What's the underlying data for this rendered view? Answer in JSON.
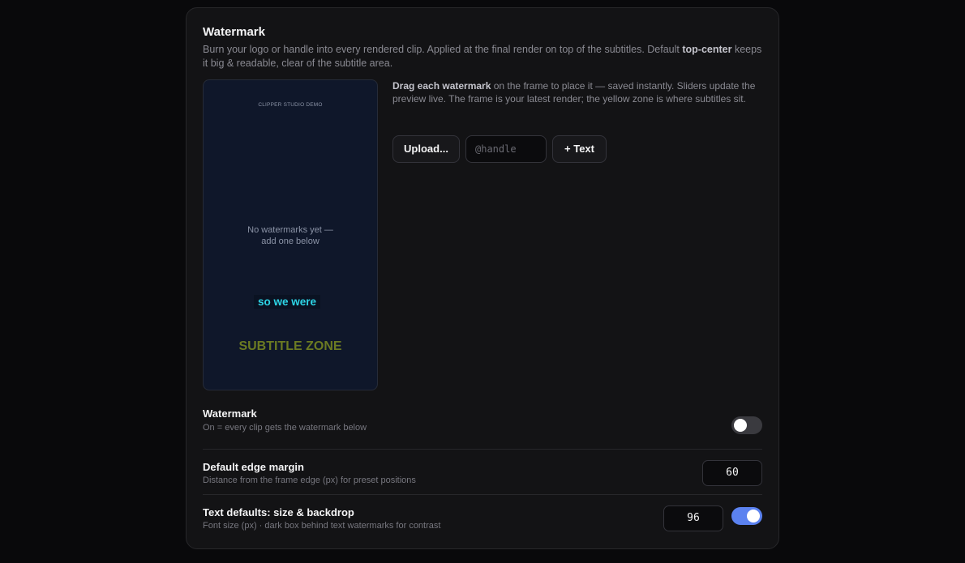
{
  "section": {
    "title": "Watermark",
    "description_pre": "Burn your logo or handle into every rendered clip. Applied at the final render on top of the subtitles. Default ",
    "description_bold": "top-center",
    "description_post": " keeps it big & readable, clear of the subtitle area."
  },
  "preview": {
    "brand": "CLIPPER STUDIO DEMO",
    "empty_line1": "No watermarks yet —",
    "empty_line2": "add one below",
    "subtitle_sample": "so we were",
    "subtitle_zone": "SUBTITLE ZONE",
    "subtitle_sample_color": "#2dd4e6",
    "subtitle_zone_color": "#6b7a22"
  },
  "help": {
    "bold": "Drag each watermark",
    "text": " on the frame to place it — saved instantly. Sliders update the preview live. The frame is your latest render; the yellow zone is where subtitles sit."
  },
  "actions": {
    "upload_label": "Upload...",
    "handle_placeholder": "@handle",
    "handle_value": "",
    "add_text_label": "+ Text"
  },
  "settings": {
    "watermark": {
      "title": "Watermark",
      "subtitle": "On = every clip gets the watermark below",
      "enabled": false
    },
    "edge_margin": {
      "title": "Default edge margin",
      "subtitle": "Distance from the frame edge (px) for preset positions",
      "value": "60"
    },
    "text_defaults": {
      "title": "Text defaults: size & backdrop",
      "subtitle": "Font size (px) · dark box behind text watermarks for contrast",
      "size": "96",
      "backdrop_enabled": true
    }
  },
  "colors": {
    "accent": "#5b82f0",
    "background": "#09090b",
    "card": "#131315",
    "preview_bg": "#0f172a"
  }
}
